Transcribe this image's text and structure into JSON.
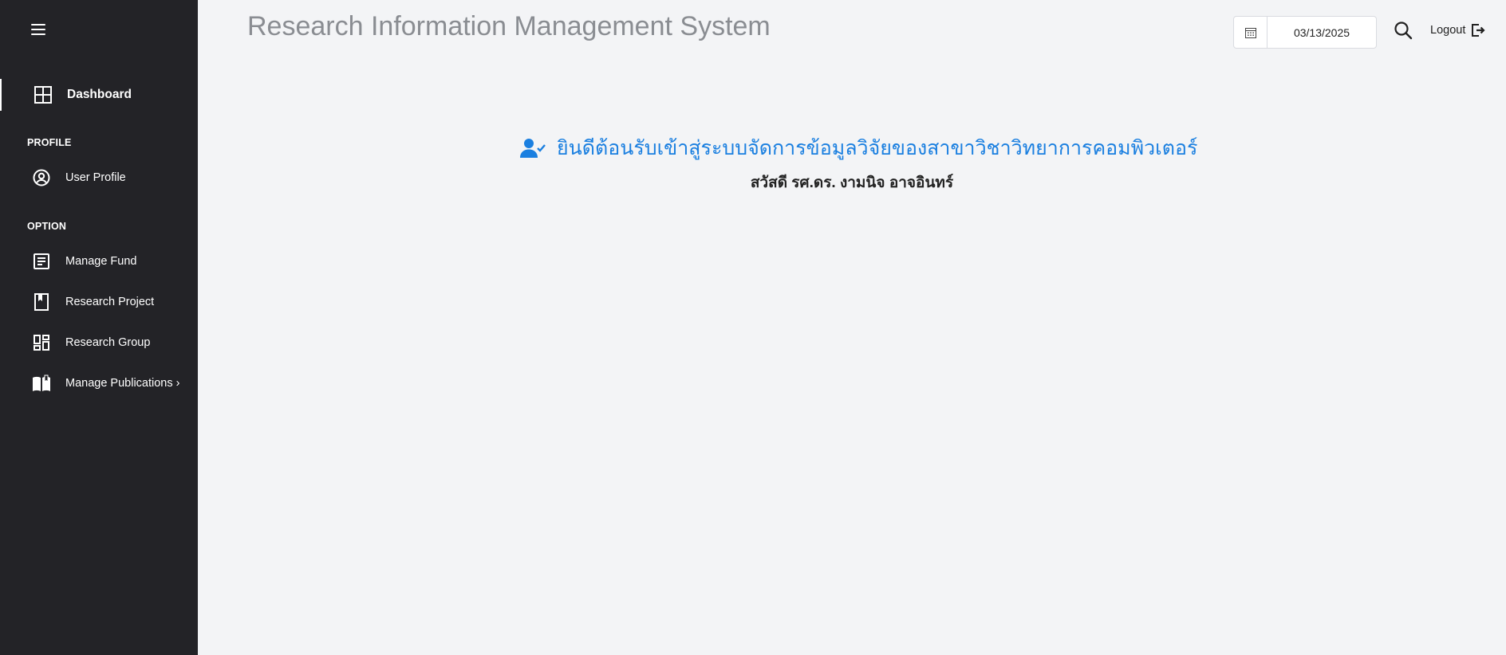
{
  "header": {
    "title": "Research Information Management System",
    "date_value": "03/13/2025",
    "logout_label": "Logout"
  },
  "sidebar": {
    "dashboard": "Dashboard",
    "section_profile": "PROFILE",
    "user_profile": "User Profile",
    "section_option": "OPTION",
    "manage_fund": "Manage Fund",
    "research_project": "Research Project",
    "research_group": "Research Group",
    "manage_publications": "Manage Publications ›"
  },
  "main": {
    "welcome": "ยินดีต้อนรับเข้าสู่ระบบจัดการข้อมูลวิจัยของสาขาวิชาวิทยาการคอมพิวเตอร์",
    "greeting": "สวัสดี รศ.ดร. งามนิจ อาจอินทร์"
  },
  "colors": {
    "sidebar_bg": "#232327",
    "accent": "#1a7fe0",
    "page_bg": "#f3f4f6"
  }
}
